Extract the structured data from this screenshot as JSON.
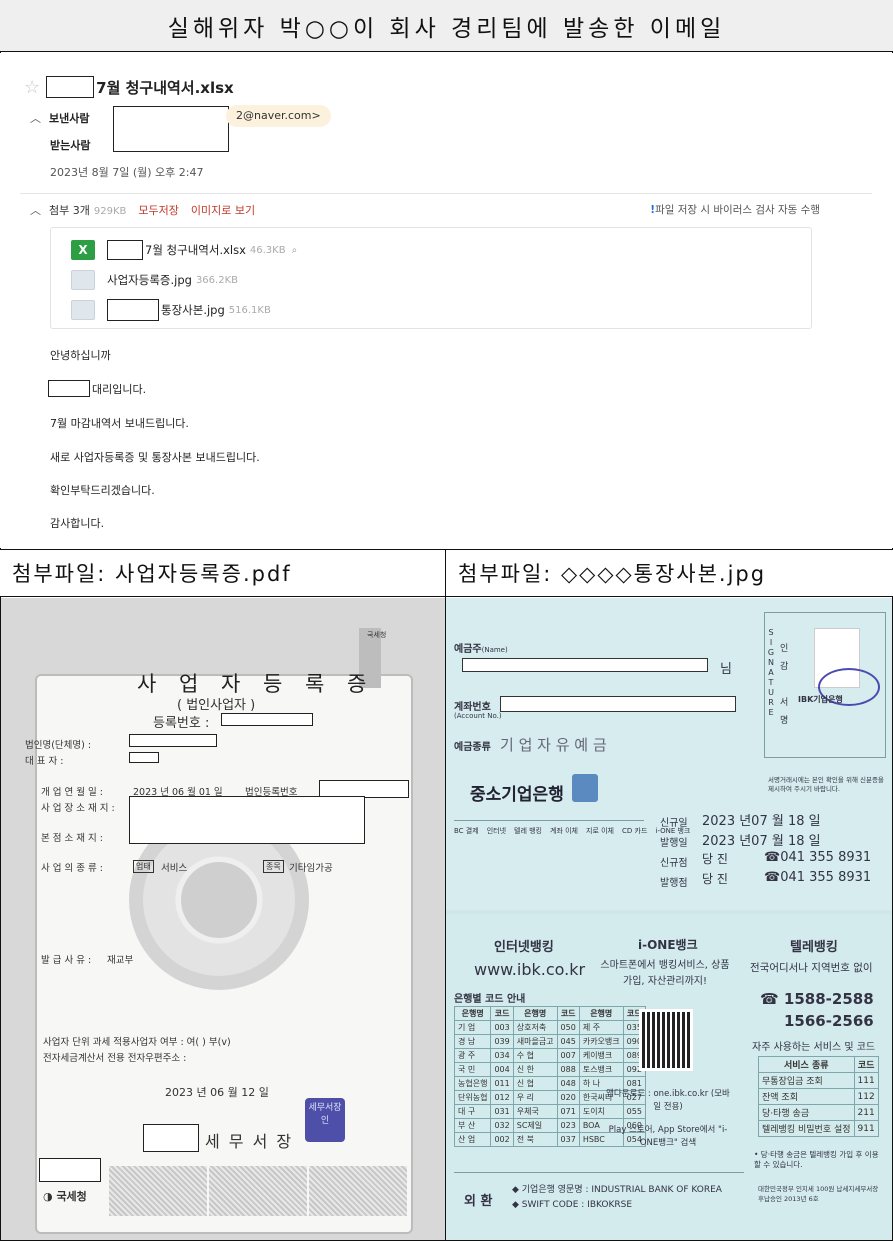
{
  "title": "실해위자 박○○이 회사 경리팀에 발송한 이메일",
  "email": {
    "subject": "7월 청구내역서.xlsx",
    "sender_label": "보낸사람",
    "sender_email": "2@naver.com>",
    "receiver_label": "받는사람",
    "date": "2023년 8월 7일 (월) 오후 2:47",
    "attach_label": "첨부 3개",
    "attach_size": "929KB",
    "save_all": "모두저장",
    "view_as_image": "이미지로 보기",
    "virus_note": "파일 저장 시 바이러스 검사 자동 수행",
    "virus_mark": "!",
    "attachments": [
      {
        "name": "7월 청구내역서.xlsx",
        "size": "46.3KB"
      },
      {
        "name": "사업자등록증.jpg",
        "size": "366.2KB"
      },
      {
        "name": "통장사본.jpg",
        "size": "516.1KB"
      }
    ],
    "body": [
      "안녕하십니까",
      "대리입니다.",
      "7월 마감내역서 보내드립니다.",
      "새로 사업자등록증 및 통장사본 보내드립니다.",
      "확인부탁드리겠습니다.",
      "감사합니다."
    ]
  },
  "panel_left_title": "첨부파일: 사업자등록증.pdf",
  "panel_right_title": "첨부파일: ◇◇◇◇통장사본.jpg",
  "certificate": {
    "agency_badge": "국세청",
    "title": "사 업 자 등 록 증",
    "subtitle": "( 법인사업자 )",
    "reg_no_label": "등록번호 :",
    "corp_name_label": "법인명(단체명) :",
    "rep_label": "대      표      자 :",
    "open_date_label": "개 업 연 월 일 :",
    "open_date": "2023 년 06 월 01 일",
    "corp_reg_label": "법인등록번호",
    "location_label": "사 업 장 소 재 지 :",
    "hq_label": "본 점 소 재 지 :",
    "biz_type_label": "사 업 의 종 류 :",
    "biz_type_tag1": "업태",
    "biz_type_1": "서비스",
    "biz_type_tag2": "종목",
    "biz_type_2": "기타임가공",
    "issue_reason_label": "발 급 사 유 :",
    "issue_reason": "재교부",
    "unit_tax_line": "사업자 단위 과세 적용사업자 여부 : 여( ) 부(v)",
    "email_line": "전자세금계산서 전용 전자우편주소 :",
    "issue_date": "2023 년 06 월 12 일",
    "office_suffix": "세 무 서 장",
    "seal_text": "세무서장인",
    "footer_logo": "국세청"
  },
  "bankbook": {
    "holder_label": "예금주",
    "holder_label_en": "(Name)",
    "holder_suffix": "님",
    "account_label": "계좌번호",
    "account_label_en": "(Account No.)",
    "type_label": "예금종류",
    "type_value": "기 업 자 유 예 금",
    "bank_name": "중소기업은행",
    "signature_vert": [
      "S",
      "I",
      "G",
      "N",
      "A",
      "T",
      "U",
      "R",
      "E"
    ],
    "seal_vert": [
      "인",
      "감",
      "",
      "서",
      "명"
    ],
    "ibk_seal": "IBK기업은행",
    "seal_note": "서명거래시에는 본인 확인을 위해 신분증을 제시하여 주시기 바랍니다.",
    "service_cols": [
      "BC 결제",
      "인터넷",
      "텔레 뱅킹",
      "계좌 이체",
      "지로 이체",
      "CD 카드",
      "i-ONE 뱅크"
    ],
    "open_label": "신규일",
    "open_date": "2023 년07 월 18 일",
    "issue_label": "발행일",
    "issue_date": "2023 년07 월 18 일",
    "open_branch_label": "신규점",
    "issue_branch_label": "발행점",
    "branch_value": "당 진",
    "branch_phone": "☎041  355 8931",
    "internet_banking_title": "인터넷뱅킹",
    "internet_url": "www.ibk.co.kr",
    "ione_title": "i-ONE뱅크",
    "ione_desc": "스마트폰에서 뱅킹서비스, 상품가입, 자산관리까지!",
    "ione_download": "앱다운로드 : one.ibk.co.kr (모바일 전용)",
    "ione_store": "Play 스토어, App Store에서 \"i-ONE뱅크\" 검색",
    "telebank_title": "텔레뱅킹",
    "telebank_desc": "전국어디서나 지역번호 없이",
    "telebank_phone1": "☎ 1588-2588",
    "telebank_phone2": "1566-2566",
    "freq_services_title": "자주 사용하는 서비스 및 코드",
    "freq_head": [
      "서비스 종류",
      "코드"
    ],
    "freq_rows": [
      [
        "무통장입금 조회",
        "111"
      ],
      [
        "잔액 조회",
        "112"
      ],
      [
        "당·타행 송금",
        "211"
      ],
      [
        "텔레뱅킹 비밀번호 설정",
        "911"
      ]
    ],
    "freq_note": "• 당·타행 송금은 텔레뱅킹 가입 후 이용 할 수 있습니다.",
    "bank_codes_title": "은행별 코드 안내",
    "bank_codes_head": [
      "은행명",
      "코드",
      "은행명",
      "코드",
      "은행명",
      "코드"
    ],
    "bank_codes_rows": [
      [
        "기   업",
        "003",
        "상호저축",
        "050",
        "제   주",
        "035"
      ],
      [
        "경   남",
        "039",
        "새마을금고",
        "045",
        "카카오뱅크",
        "090"
      ],
      [
        "광   주",
        "034",
        "수   협",
        "007",
        "케이뱅크",
        "089"
      ],
      [
        "국   민",
        "004",
        "신   한",
        "088",
        "토스뱅크",
        "092"
      ],
      [
        "농협은행",
        "011",
        "신   협",
        "048",
        "하   나",
        "081"
      ],
      [
        "단위농협",
        "012",
        "우   리",
        "020",
        "한국씨티",
        "027"
      ],
      [
        "대   구",
        "031",
        "우체국",
        "071",
        "도이치",
        "055"
      ],
      [
        "부   산",
        "032",
        "SC제일",
        "023",
        "BOA",
        "060"
      ],
      [
        "산   업",
        "002",
        "전   북",
        "037",
        "HSBC",
        "054"
      ]
    ],
    "foreign_label": "외 환",
    "english_name": "◆ 기업은행 영문명 : INDUSTRIAL BANK OF KOREA",
    "swift": "◆ SWIFT CODE : IBKOKRSE",
    "footer_note": "대한민국정부 인지세 100원 납세지세무서장 후납승인 2013년 6호"
  }
}
